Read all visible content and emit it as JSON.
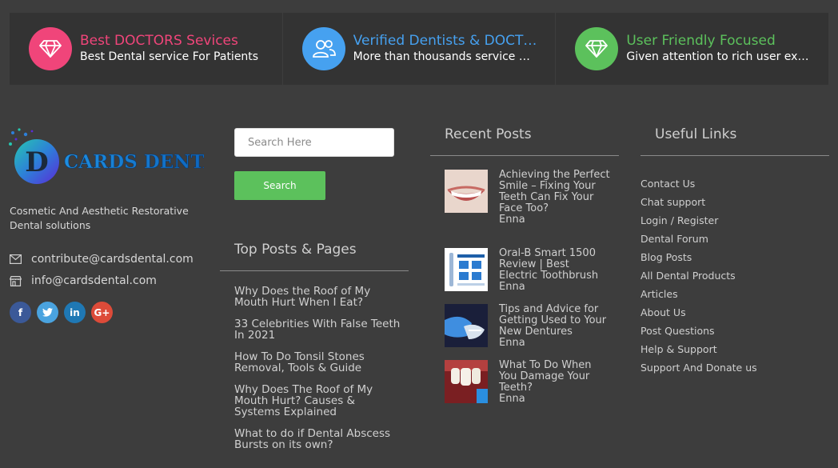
{
  "features": [
    {
      "title": "Best DOCTORS Sevices",
      "subtitle": "Best Dental service For Patients",
      "color": "#f0457a",
      "title_color": "#f0457a",
      "icon": "diamond-icon"
    },
    {
      "title": "Verified Dentists & DOCTORS",
      "subtitle": "More than thousands service providers",
      "color": "#46a1f0",
      "title_color": "#46a1f0",
      "icon": "users-icon"
    },
    {
      "title": "User Friendly Focused",
      "subtitle": "Given attention to rich user experience",
      "color": "#5cc15c",
      "title_color": "#5cc15c",
      "icon": "diamond-icon"
    }
  ],
  "brand": {
    "logo_text": "CARDS DENTAL",
    "about": "Cosmetic And Aesthetic Restorative Dental solutions"
  },
  "contacts": [
    {
      "icon": "envelope-icon",
      "text": "contribute@cardsdental.com"
    },
    {
      "icon": "store-icon",
      "text": "info@cardsdental.com"
    }
  ],
  "socials": [
    {
      "name": "facebook",
      "glyph": "f",
      "color": "#3b5998"
    },
    {
      "name": "twitter",
      "glyph": "t",
      "color": "#4aa3df"
    },
    {
      "name": "linkedin",
      "glyph": "in",
      "color": "#1f78b4"
    },
    {
      "name": "google-plus",
      "glyph": "G+",
      "color": "#dd4b39"
    }
  ],
  "search": {
    "placeholder": "Search Here",
    "button_label": "Search"
  },
  "top_posts": {
    "heading": "Top Posts & Pages",
    "items": [
      "Why Does the Roof of My Mouth Hurt When I Eat?",
      "33 Celebrities With False Teeth In 2021",
      "How To Do Tonsil Stones Removal, Tools & Guide",
      "Why Does The Roof of My Mouth Hurt? Causes & Systems Explained",
      "What to do if Dental Abscess Bursts on its own?"
    ]
  },
  "recent_posts": {
    "heading": "Recent Posts",
    "items": [
      {
        "title": "Achieving the Perfect Smile – Fixing Your Teeth Can Fix Your Face Too?",
        "author": "Enna"
      },
      {
        "title": "Oral-B Smart 1500 Review | Best Electric Toothbrush",
        "author": "Enna"
      },
      {
        "title": "Tips and Advice for Getting Used to Your New Dentures",
        "author": "Enna"
      },
      {
        "title": "What To Do When You Damage Your Teeth?",
        "author": "Enna"
      }
    ]
  },
  "useful_links": {
    "heading": "Useful Links",
    "items": [
      "Contact Us",
      "Chat support",
      "Login / Register",
      "Dental Forum",
      "Blog Posts",
      "All Dental Products",
      "Articles",
      "About Us",
      "Post Questions",
      "Help & Support",
      "Support And Donate us"
    ]
  }
}
